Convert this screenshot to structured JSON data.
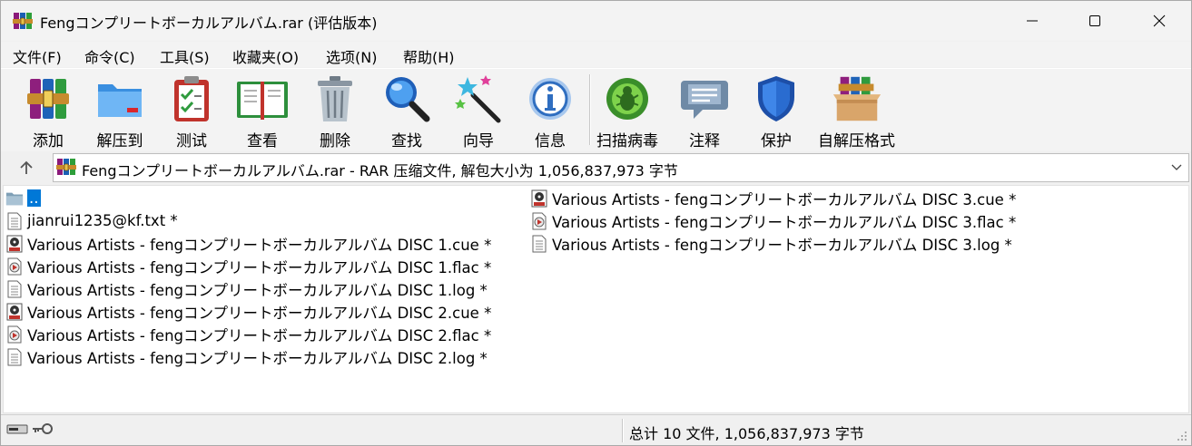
{
  "window": {
    "title": "Fengコンプリートボーカルアルバム.rar (评估版本)"
  },
  "menu": [
    {
      "label": "文件(F)"
    },
    {
      "label": "命令(C)"
    },
    {
      "label": "工具(S)"
    },
    {
      "label": "收藏夹(O)"
    },
    {
      "label": "选项(N)"
    },
    {
      "label": "帮助(H)"
    }
  ],
  "toolbar": [
    {
      "label": "添加",
      "icon": "add-archive-icon"
    },
    {
      "label": "解压到",
      "icon": "extract-folder-icon"
    },
    {
      "label": "测试",
      "icon": "test-clipboard-icon"
    },
    {
      "label": "查看",
      "icon": "view-book-icon"
    },
    {
      "label": "删除",
      "icon": "trash-icon"
    },
    {
      "label": "查找",
      "icon": "magnifier-icon"
    },
    {
      "label": "向导",
      "icon": "wizard-wand-icon"
    },
    {
      "label": "信息",
      "icon": "info-icon"
    },
    {
      "label": "扫描病毒",
      "icon": "virus-scan-icon"
    },
    {
      "label": "注释",
      "icon": "comment-icon"
    },
    {
      "label": "保护",
      "icon": "shield-icon"
    },
    {
      "label": "自解压格式",
      "icon": "sfx-box-icon"
    }
  ],
  "address": {
    "text": "Fengコンプリートボーカルアルバム.rar - RAR 压缩文件, 解包大小为 1,056,837,973 字节"
  },
  "files": [
    {
      "name": "..",
      "type": "parent-folder",
      "selected": true
    },
    {
      "name": "jianrui1235@kf.txt *",
      "type": "text"
    },
    {
      "name": "Various Artists - fengコンプリートボーカルアルバム DISC 1.cue *",
      "type": "cue"
    },
    {
      "name": "Various Artists - fengコンプリートボーカルアルバム DISC 1.flac *",
      "type": "flac"
    },
    {
      "name": "Various Artists - fengコンプリートボーカルアルバム DISC 1.log *",
      "type": "text"
    },
    {
      "name": "Various Artists - fengコンプリートボーカルアルバム DISC 2.cue *",
      "type": "cue"
    },
    {
      "name": "Various Artists - fengコンプリートボーカルアルバム DISC 2.flac *",
      "type": "flac"
    },
    {
      "name": "Various Artists - fengコンプリートボーカルアルバム DISC 2.log *",
      "type": "text"
    },
    {
      "name": "Various Artists - fengコンプリートボーカルアルバム DISC 3.cue *",
      "type": "cue"
    },
    {
      "name": "Various Artists - fengコンプリートボーカルアルバム DISC 3.flac *",
      "type": "flac"
    },
    {
      "name": "Various Artists - fengコンプリートボーカルアルバム DISC 3.log *",
      "type": "text"
    }
  ],
  "status": {
    "summary": "总计 10 文件, 1,056,837,973 字节"
  },
  "colors": {
    "selection": "#0078d7",
    "background": "#f0f0f0"
  }
}
